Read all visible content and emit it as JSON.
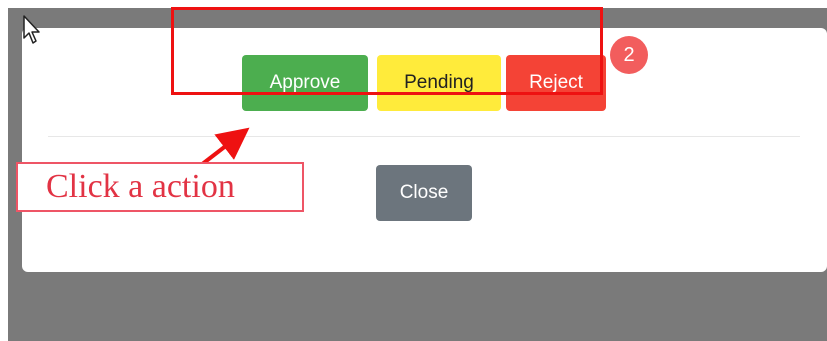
{
  "dialog": {
    "actions": {
      "approve_label": "Approve",
      "pending_label": "Pending",
      "reject_label": "Reject"
    },
    "close_label": "Close"
  },
  "annotation": {
    "step_number": "2",
    "callout_text": "Click a action",
    "highlight_color": "#ee1111"
  },
  "colors": {
    "approve": "#4cae4f",
    "pending": "#ffeb3b",
    "reject": "#f44336",
    "close": "#6c757d",
    "backdrop": "#7a7a7a"
  },
  "icons": [
    "mouse-pointer-icon"
  ]
}
